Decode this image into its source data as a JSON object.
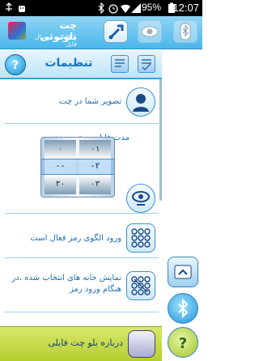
{
  "status_bar": {
    "battery_percent": "95%",
    "time": "12:07",
    "icons": [
      "usb-icon",
      "android-debug-icon",
      "bluetooth-icon",
      "alarm-icon",
      "wifi-icon",
      "signal-icon",
      "battery-icon"
    ]
  },
  "app_header": {
    "title": "چت بلوتوثی",
    "subtitle": "با قابلیت ارسال فایل",
    "buttons": [
      "settings-tools-icon",
      "eye-icon",
      "bluetooth-icon"
    ]
  },
  "sub_header": {
    "title": "تنظیمات"
  },
  "settings": {
    "profile_picture_label": "تصویر شما در چت",
    "discoverable_label": "مدت قابل جستجوبودن\nثانیه دقیقه",
    "picker": {
      "left_column": [
        "۰",
        "۰۰",
        "۳۰"
      ],
      "right_column": [
        "۰۱",
        "۰۲",
        "۰۳"
      ]
    },
    "pattern_label": "ورود الگوی رمز فعال است",
    "show_cells_label": "نمایش خانه های انتخاب شده ،در هنگام ورود رمز",
    "about_label": "درباره بلو چت فایلی"
  },
  "colors": {
    "header": "#4ab6ea",
    "accent": "#1c6fb8",
    "about_bar": "#c6db40"
  }
}
